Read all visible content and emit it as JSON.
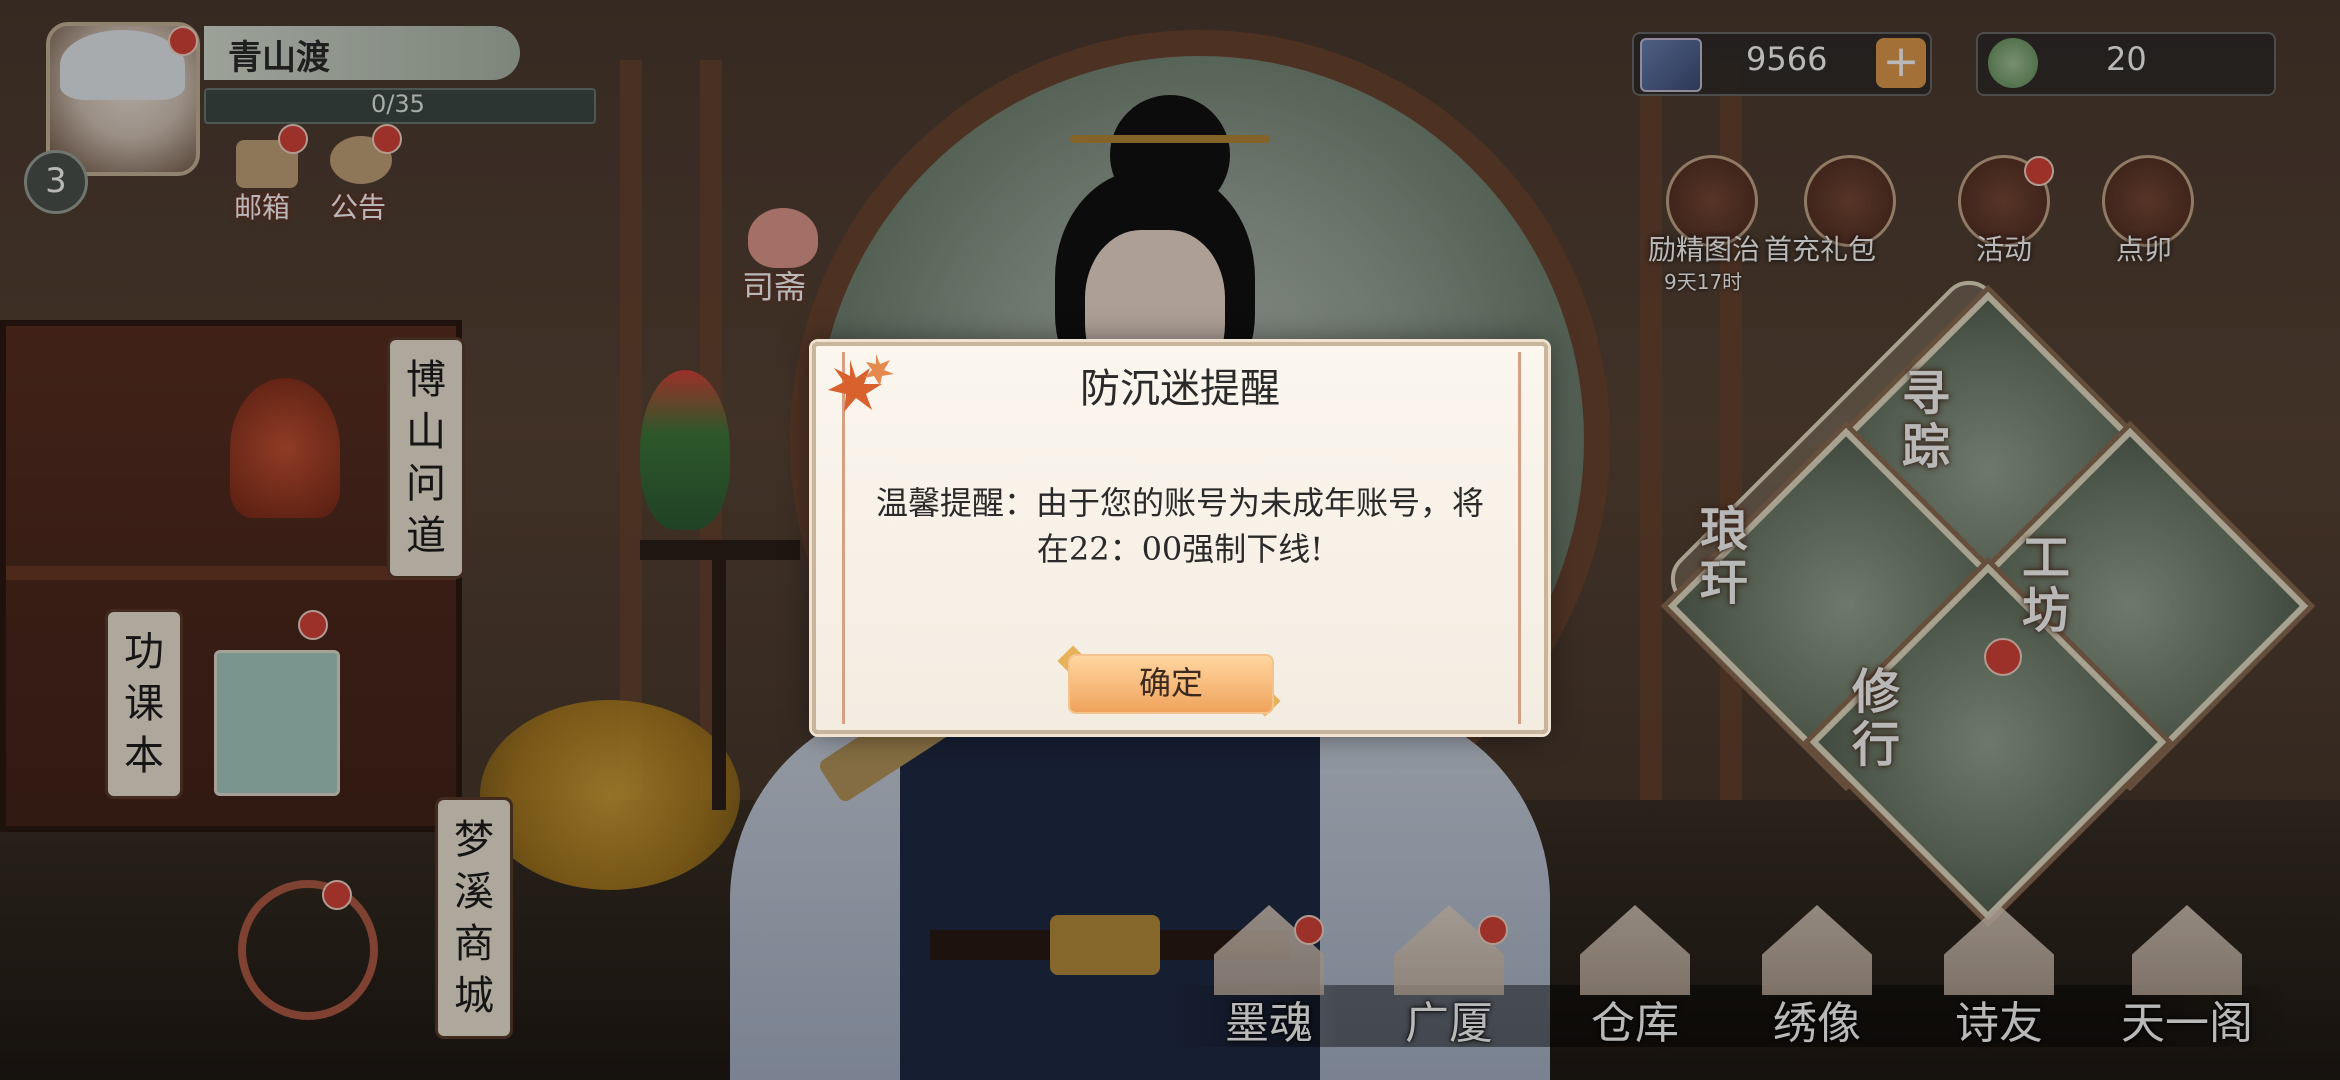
{
  "player": {
    "name": "青山渡",
    "level": "3",
    "exp": "0/35"
  },
  "top_left_icons": [
    {
      "label": "邮箱"
    },
    {
      "label": "公告"
    }
  ],
  "currency": {
    "gems": "9566",
    "coins": "20"
  },
  "right_icons": [
    {
      "label": "励精图治",
      "timer": "9天17时"
    },
    {
      "label": "首充礼包"
    },
    {
      "label": "活动"
    },
    {
      "label": "点卯"
    }
  ],
  "scene_labels": {
    "sijiang": "司斋",
    "boshan": "博山问道",
    "gongke": "功课本",
    "mengxi": "梦溪商城"
  },
  "diamond_menu": {
    "xunzong": "寻踪",
    "gongfang": "工坊",
    "langgan": "琅玕",
    "xiuxing": "修行"
  },
  "bottom_nav": [
    {
      "label": "墨魂"
    },
    {
      "label": "广厦"
    },
    {
      "label": "仓库"
    },
    {
      "label": "绣像"
    },
    {
      "label": "诗友"
    },
    {
      "label": "天一阁"
    }
  ],
  "dialog": {
    "title": "防沉迷提醒",
    "message": "温馨提醒：由于您的账号为未成年账号，将在22：00强制下线!",
    "confirm_label": "确定"
  },
  "colors": {
    "accent": "#f0a35c",
    "badge_red": "#d9443a",
    "dialog_bg": "#fbf6ee"
  }
}
